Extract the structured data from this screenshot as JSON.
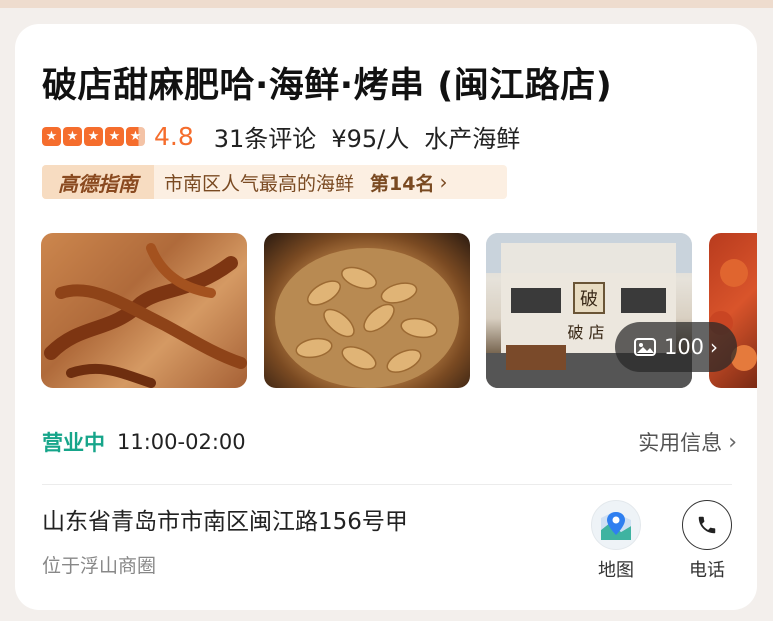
{
  "shop": {
    "name": "破店甜麻肥哈·海鲜·烤串 (闽江路店)",
    "rating": 4.8,
    "rating_text": "4.8",
    "reviews": "31条评论",
    "price": "¥95/人",
    "category": "水产海鲜"
  },
  "rank": {
    "brand": "高德指南",
    "text": "市南区人气最高的海鲜",
    "position": "第14名",
    "arrow": "›"
  },
  "gallery": {
    "count": "100",
    "arrow": "›",
    "photos": [
      "fried-chicken-feet",
      "boiled-peanuts",
      "storefront",
      "crayfish"
    ],
    "sign_char": "破",
    "sign_text": "破 店"
  },
  "status": {
    "open": "营业中",
    "hours": "11:00-02:00",
    "info_label": "实用信息",
    "arrow": "›"
  },
  "location": {
    "address": "山东省青岛市市南区闽江路156号甲",
    "area": "位于浮山商圈"
  },
  "actions": {
    "map_label": "地图",
    "phone_label": "电话"
  },
  "colors": {
    "accent": "#f56d2d",
    "open": "#16a58a",
    "rank_bg": "#fcefe2"
  }
}
